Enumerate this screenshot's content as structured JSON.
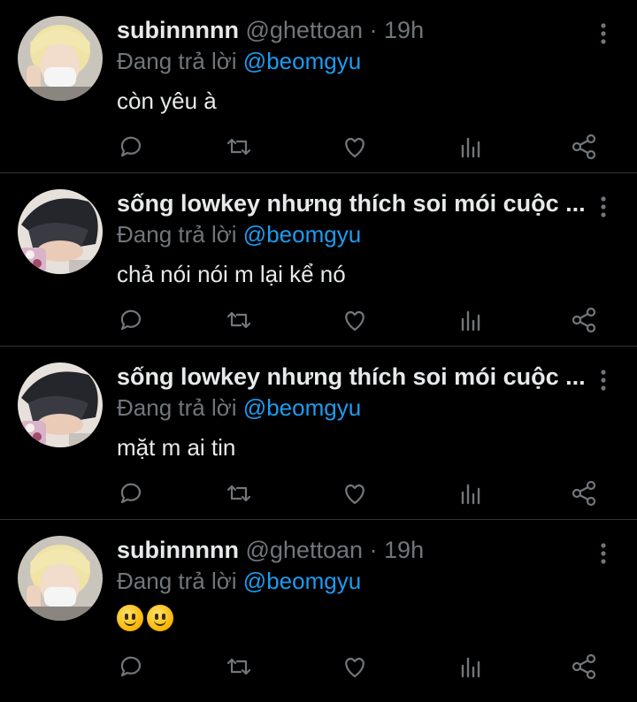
{
  "tweets": [
    {
      "name": "subinnnnn",
      "handle": "@ghettoan",
      "separator": "·",
      "time": "19h",
      "reply_prefix": "Đang trả lời",
      "reply_to": "@beomgyu",
      "text": "còn yêu à",
      "avatar": "blonde-masked-avatar"
    },
    {
      "name": "sống lowkey nhưng thích soi mói cuộc ...",
      "handle": "",
      "separator": "",
      "time": "",
      "reply_prefix": "Đang trả lời",
      "reply_to": "@beomgyu",
      "text": "chả nói nói m lại kể nó",
      "avatar": "dark-hair-avatar"
    },
    {
      "name": "sống lowkey nhưng thích soi mói cuộc ...",
      "handle": "",
      "separator": "",
      "time": "",
      "reply_prefix": "Đang trả lời",
      "reply_to": "@beomgyu",
      "text": "mặt m ai tin",
      "avatar": "dark-hair-avatar"
    },
    {
      "name": "subinnnnn",
      "handle": "@ghettoan",
      "separator": "·",
      "time": "19h",
      "reply_prefix": "Đang trả lời",
      "reply_to": "@beomgyu",
      "text": "",
      "emojis": [
        "slightly-smiling-face",
        "slightly-smiling-face"
      ],
      "avatar": "blonde-masked-avatar"
    }
  ],
  "action_icons": [
    "reply-icon",
    "retweet-icon",
    "like-icon",
    "analytics-icon",
    "share-icon"
  ],
  "colors": {
    "background": "#000000",
    "text": "#e7e9ea",
    "muted": "#71767b",
    "mention": "#1d9bf0",
    "divider": "#2f3336"
  }
}
